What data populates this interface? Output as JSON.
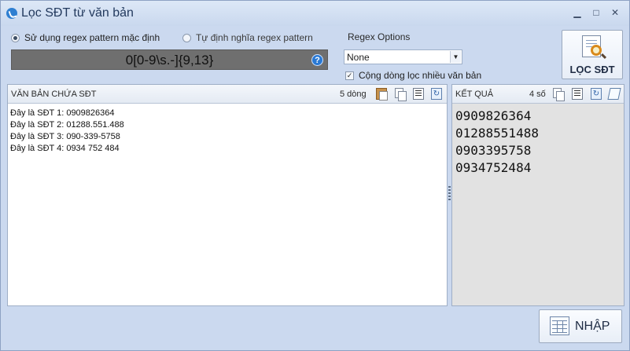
{
  "window": {
    "title": "Lọc SĐT từ văn bản",
    "controls": [
      "minimize",
      "maximize",
      "close"
    ]
  },
  "options": {
    "radio_default": "Sử dụng regex pattern mặc định",
    "radio_custom": "Tự định nghĩa regex pattern",
    "pattern": "0[0-9\\s.-]{9,13}",
    "regex_options_label": "Regex Options",
    "regex_options_value": "None",
    "checkbox_label": "Cộng dòng lọc nhiều văn bản"
  },
  "buttons": {
    "filter": "LỌC SĐT",
    "import": "NHẬP"
  },
  "left_panel": {
    "title": "VĂN BẢN CHỨA SĐT",
    "count": "5 dòng",
    "lines": [
      "Đây là SĐT 1: 0909826364",
      "Đây là SĐT 2: 01288.551.488",
      "Đây là SĐT 3: 090-339-5758",
      "Đây là SĐT 4: 0934 752 484"
    ]
  },
  "right_panel": {
    "title": "KẾT QUẢ",
    "count": "4 số",
    "results": [
      "0909826364",
      "01288551488",
      "0903395758",
      "0934752484"
    ]
  },
  "icons": {
    "app": "phone-icon",
    "help": "help-icon",
    "paste": "clipboard-icon",
    "copy": "copy-icon",
    "list": "list-icon",
    "refresh": "refresh-icon",
    "edit": "edit-icon"
  },
  "colors": {
    "background": "#cbd9ef",
    "pattern_box": "#6f6f6f",
    "results_background": "#e2e2e2",
    "accent": "#2a79d4"
  }
}
